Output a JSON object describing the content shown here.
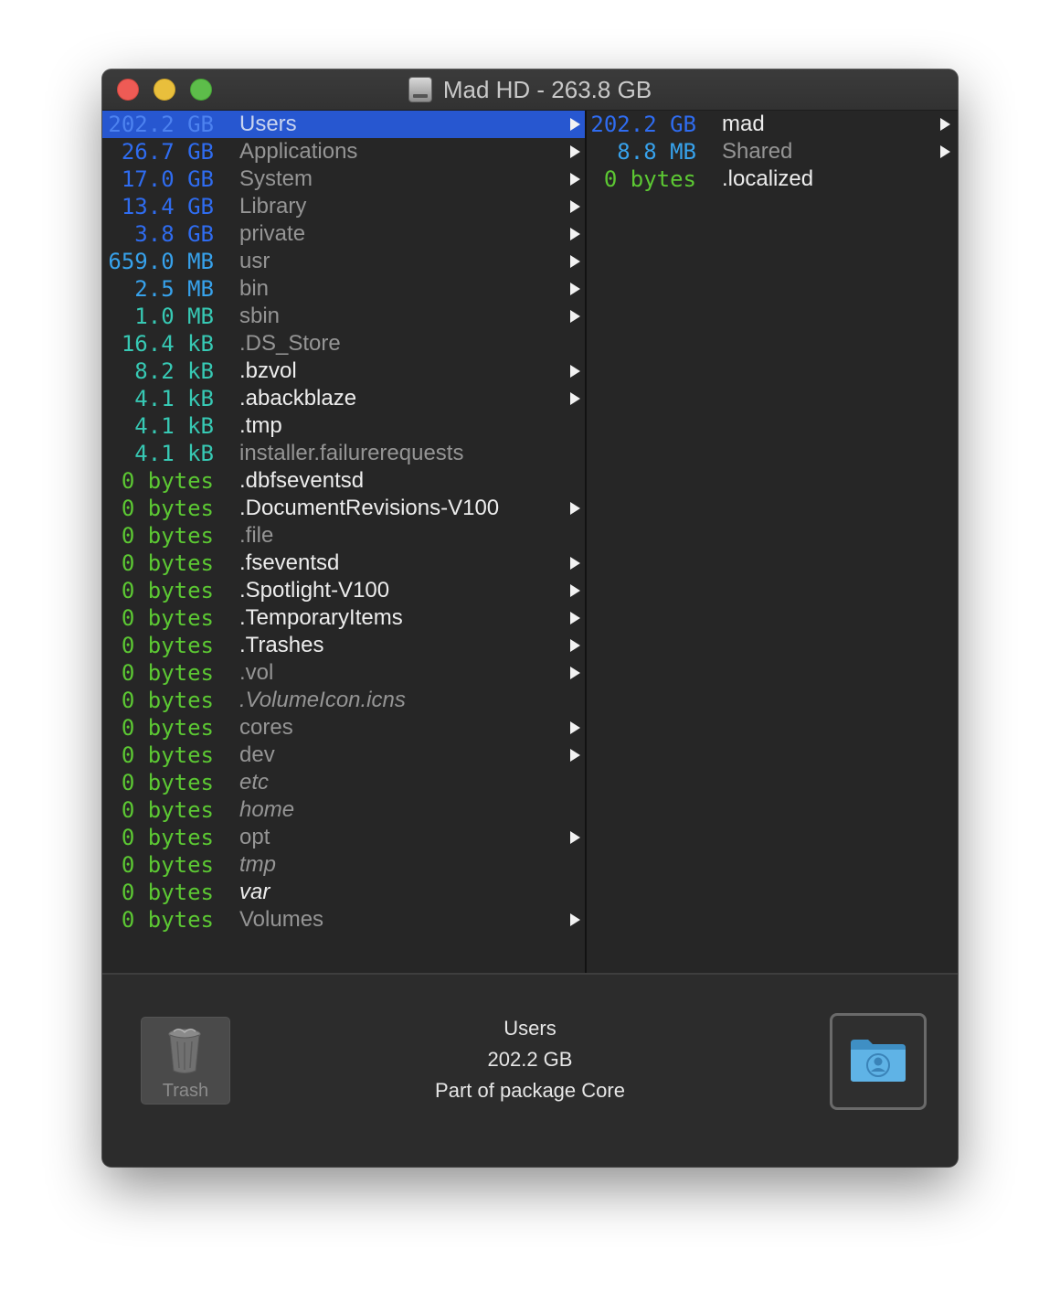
{
  "window": {
    "title": "Mad HD - 263.8 GB",
    "title_icon": "hard-disk-icon"
  },
  "column1": [
    {
      "size": "202.2 GB",
      "name": "Users",
      "size_color": "#4d82ef",
      "name_style": "selected",
      "arrow": true,
      "selected": true
    },
    {
      "size": "26.7 GB",
      "name": "Applications",
      "size_color": "#2f6cf0",
      "name_style": "gray",
      "arrow": true
    },
    {
      "size": "17.0 GB",
      "name": "System",
      "size_color": "#2f6cf0",
      "name_style": "gray",
      "arrow": true
    },
    {
      "size": "13.4 GB",
      "name": "Library",
      "size_color": "#2f6cf0",
      "name_style": "gray",
      "arrow": true
    },
    {
      "size": "3.8 GB",
      "name": "private",
      "size_color": "#2f6cf0",
      "name_style": "gray",
      "arrow": true
    },
    {
      "size": "659.0 MB",
      "name": "usr",
      "size_color": "#37a2ec",
      "name_style": "gray",
      "arrow": true
    },
    {
      "size": "2.5 MB",
      "name": "bin",
      "size_color": "#37a2ec",
      "name_style": "gray",
      "arrow": true
    },
    {
      "size": "1.0 MB",
      "name": "sbin",
      "size_color": "#37c9b4",
      "name_style": "gray",
      "arrow": true
    },
    {
      "size": "16.4 kB",
      "name": ".DS_Store",
      "size_color": "#37c9b4",
      "name_style": "gray",
      "arrow": false
    },
    {
      "size": "8.2 kB",
      "name": ".bzvol",
      "size_color": "#37c9b4",
      "name_style": "white",
      "arrow": true
    },
    {
      "size": "4.1 kB",
      "name": ".abackblaze",
      "size_color": "#37c9b4",
      "name_style": "white",
      "arrow": true
    },
    {
      "size": "4.1 kB",
      "name": ".tmp",
      "size_color": "#37c9b4",
      "name_style": "white",
      "arrow": false
    },
    {
      "size": "4.1 kB",
      "name": "installer.failurerequests",
      "size_color": "#37c9b4",
      "name_style": "gray",
      "arrow": false
    },
    {
      "size": "0 bytes",
      "name": ".dbfseventsd",
      "size_color": "#5cc833",
      "name_style": "white",
      "arrow": false
    },
    {
      "size": "0 bytes",
      "name": ".DocumentRevisions-V100",
      "size_color": "#5cc833",
      "name_style": "white",
      "arrow": true
    },
    {
      "size": "0 bytes",
      "name": ".file",
      "size_color": "#5cc833",
      "name_style": "gray",
      "arrow": false
    },
    {
      "size": "0 bytes",
      "name": ".fseventsd",
      "size_color": "#5cc833",
      "name_style": "white",
      "arrow": true
    },
    {
      "size": "0 bytes",
      "name": ".Spotlight-V100",
      "size_color": "#5cc833",
      "name_style": "white",
      "arrow": true
    },
    {
      "size": "0 bytes",
      "name": ".TemporaryItems",
      "size_color": "#5cc833",
      "name_style": "white",
      "arrow": true
    },
    {
      "size": "0 bytes",
      "name": ".Trashes",
      "size_color": "#5cc833",
      "name_style": "white",
      "arrow": true
    },
    {
      "size": "0 bytes",
      "name": ".vol",
      "size_color": "#5cc833",
      "name_style": "gray",
      "arrow": true
    },
    {
      "size": "0 bytes",
      "name": ".VolumeIcon.icns",
      "size_color": "#5cc833",
      "name_style": "gray-italic",
      "arrow": false
    },
    {
      "size": "0 bytes",
      "name": "cores",
      "size_color": "#5cc833",
      "name_style": "gray",
      "arrow": true
    },
    {
      "size": "0 bytes",
      "name": "dev",
      "size_color": "#5cc833",
      "name_style": "gray",
      "arrow": true
    },
    {
      "size": "0 bytes",
      "name": "etc",
      "size_color": "#5cc833",
      "name_style": "gray-italic",
      "arrow": false
    },
    {
      "size": "0 bytes",
      "name": "home",
      "size_color": "#5cc833",
      "name_style": "gray-italic",
      "arrow": false
    },
    {
      "size": "0 bytes",
      "name": "opt",
      "size_color": "#5cc833",
      "name_style": "gray",
      "arrow": true
    },
    {
      "size": "0 bytes",
      "name": "tmp",
      "size_color": "#5cc833",
      "name_style": "gray-italic",
      "arrow": false
    },
    {
      "size": "0 bytes",
      "name": "var",
      "size_color": "#5cc833",
      "name_style": "white-italic",
      "arrow": false
    },
    {
      "size": "0 bytes",
      "name": "Volumes",
      "size_color": "#5cc833",
      "name_style": "gray",
      "arrow": true
    }
  ],
  "column2": [
    {
      "size": "202.2 GB",
      "name": "mad",
      "size_color": "#2f6cf0",
      "name_style": "white",
      "arrow": true
    },
    {
      "size": "8.8 MB",
      "name": "Shared",
      "size_color": "#37a2ec",
      "name_style": "gray",
      "arrow": true
    },
    {
      "size": "0 bytes",
      "name": ".localized",
      "size_color": "#5cc833",
      "name_style": "white",
      "arrow": false
    }
  ],
  "footer": {
    "trash_label": "Trash",
    "trash_icon": "trash-icon",
    "info_name": "Users",
    "info_size": "202.2 GB",
    "info_package": "Part of package Core",
    "folder_icon": "user-folder-icon"
  }
}
